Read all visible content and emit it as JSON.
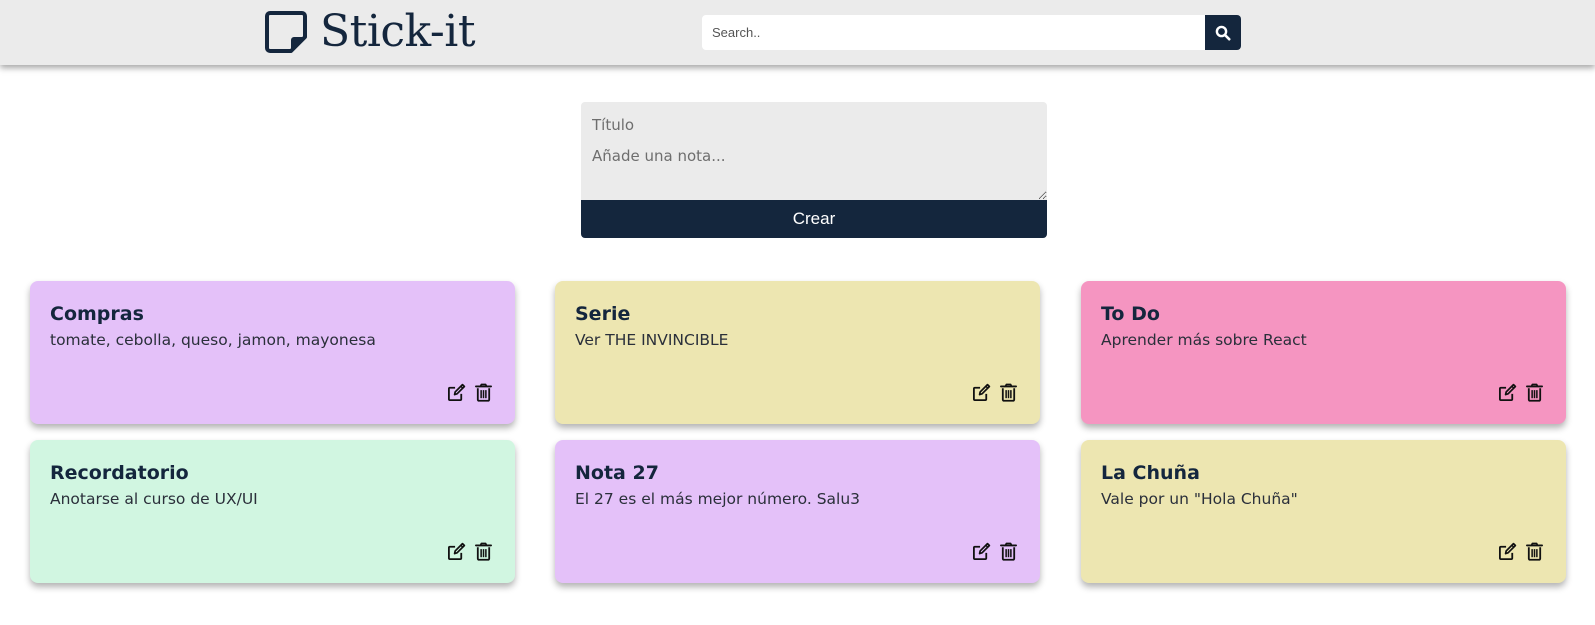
{
  "header": {
    "logo_text": "Stick-it",
    "search_placeholder": "Search.."
  },
  "create_form": {
    "title_placeholder": "Título",
    "note_placeholder": "Añade una nota...",
    "create_label": "Crear"
  },
  "notes": [
    {
      "title": "Compras",
      "body": "tomate, cebolla, queso, jamon, mayonesa",
      "color": "#e4c1f9"
    },
    {
      "title": "Serie",
      "body": "Ver THE INVINCIBLE",
      "color": "#ede6b1"
    },
    {
      "title": "To Do",
      "body": "Aprender más sobre React",
      "color": "#f595c1"
    },
    {
      "title": "Recordatorio",
      "body": "Anotarse al curso de UX/UI",
      "color": "#d1f6e1"
    },
    {
      "title": "Nota 27",
      "body": "El 27 es el más mejor número. Salu3",
      "color": "#e4c1f9"
    },
    {
      "title": "La Chuña",
      "body": "Vale por un \"Hola Chuña\"",
      "color": "#ede6b1"
    }
  ],
  "icons": {
    "logo": "sticky-note-icon",
    "search": "search-icon",
    "edit": "edit-icon",
    "delete": "trash-icon"
  },
  "colors": {
    "brand": "#14263d",
    "header_bg": "#ebebeb"
  }
}
